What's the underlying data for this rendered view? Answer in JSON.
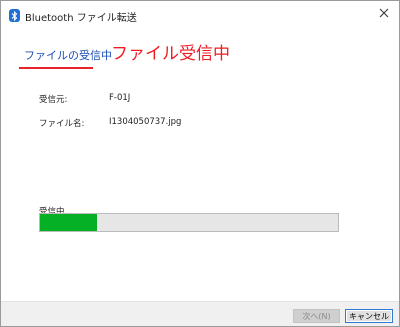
{
  "window": {
    "title": "Bluetooth ファイル転送",
    "bluetooth_icon": "bluetooth-icon",
    "close_icon": "close-icon"
  },
  "heading": {
    "text": "ファイルの受信中",
    "underline_color": "#e8222a"
  },
  "annotation": {
    "text": "ファイル受信中",
    "color": "#ee1c24"
  },
  "details": {
    "sender_label": "受信元:",
    "sender_value": "F-01J",
    "filename_label": "ファイル名:",
    "filename_value": "I1304050737.jpg"
  },
  "progress": {
    "label": "受信中...",
    "percent": 19,
    "fill_color": "#06b025"
  },
  "footer": {
    "next_label": "次へ(N)",
    "cancel_label": "キャンセル"
  }
}
